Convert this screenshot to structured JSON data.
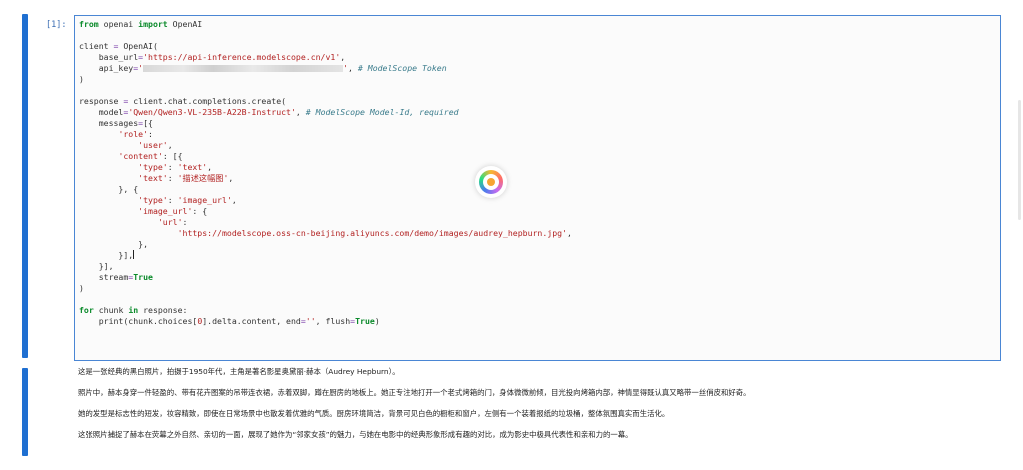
{
  "cell": {
    "prompt": "[1]:",
    "code_lines": [
      [
        "kw:from",
        "t: openai ",
        "kw:import",
        "t: OpenAI"
      ],
      [],
      [
        "t:client ",
        "op:=",
        "t: OpenAI("
      ],
      [
        "t:    base_url",
        "op:=",
        "str:'https://api-inference.modelscope.cn/v1'",
        "t:,"
      ],
      [
        "t:    api_key",
        "op:=",
        "str:'",
        "blur:",
        "str:'",
        "t:, ",
        "cm:# ModelScope Token"
      ],
      [
        "t:)"
      ],
      [],
      [
        "t:response ",
        "op:=",
        "t: client.chat.completions.create("
      ],
      [
        "t:    model",
        "op:=",
        "str:'Qwen/Qwen3-VL-235B-A22B-Instruct'",
        "t:, ",
        "cm:# ModelScope Model-Id, required"
      ],
      [
        "t:    messages",
        "op:=",
        "t:[{"
      ],
      [
        "t:        ",
        "str:'role'",
        "t::"
      ],
      [
        "t:            ",
        "str:'user'",
        "t:,"
      ],
      [
        "t:        ",
        "str:'content'",
        "t:: [{"
      ],
      [
        "t:            ",
        "str:'type'",
        "t:: ",
        "str:'text'",
        "t:,"
      ],
      [
        "t:            ",
        "str:'text'",
        "t:: ",
        "str:'描述这幅图'",
        "t:,"
      ],
      [
        "t:        }, {"
      ],
      [
        "t:            ",
        "str:'type'",
        "t:: ",
        "str:'image_url'",
        "t:,"
      ],
      [
        "t:            ",
        "str:'image_url'",
        "t:: {"
      ],
      [
        "t:                ",
        "str:'url'",
        "t::"
      ],
      [
        "t:                    ",
        "str:'https://modelscope.oss-cn-beijing.aliyuncs.com/demo/images/audrey_hepburn.jpg'",
        "t:,"
      ],
      [
        "t:            },"
      ],
      [
        "t:        }],",
        "cursor:"
      ],
      [
        "t:    }],"
      ],
      [
        "t:    stream",
        "op:=",
        "kw:True"
      ],
      [
        "t:)"
      ],
      [],
      [
        "kw:for",
        "t: chunk ",
        "kw:in",
        "t: response:"
      ],
      [
        "t:    print(chunk.choices[",
        "str:0",
        "t:].delta.content, end",
        "op:=",
        "str:''",
        "t:, flush",
        "op:=",
        "kw:True",
        "t:)"
      ]
    ]
  },
  "output": {
    "paragraphs": [
      "这是一张经典的黑白照片，拍摄于1950年代，主角是著名影星奥黛丽·赫本（Audrey Hepburn）。",
      "照片中，赫本身穿一件轻盈的、带有花卉图案的吊带连衣裙，赤着双脚，蹲在厨房的地板上。她正专注地打开一个老式烤箱的门，身体微微前倾，目光投向烤箱内部，神情显得既认真又略带一丝俏皮和好奇。",
      "她的发型是标志性的短发，妆容精致，即使在日常场景中也散发着优雅的气质。厨房环境简洁，背景可见白色的橱柜和窗户，左侧有一个装着报纸的垃圾桶，整体氛围真实而生活化。",
      "这张照片捕捉了赫本在荧幕之外自然、亲切的一面，展现了她作为“邻家女孩”的魅力，与她在电影中的经典形象形成有趣的对比，成为影史中极具代表性和亲和力的一幕。"
    ]
  },
  "colors": {
    "keyword": "#0a8a2a",
    "string": "#b22222",
    "comment": "#3b7c8c",
    "operator": "#7a3eaa",
    "active_bar": "#1f6fd1",
    "cell_border": "#4a86d4"
  },
  "icons": {
    "loading": "loading-spinner-icon"
  }
}
